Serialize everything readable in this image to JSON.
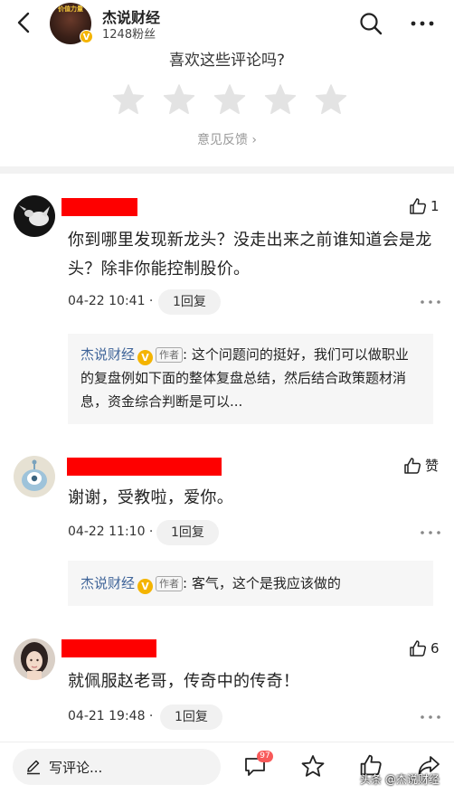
{
  "header": {
    "account_name": "杰说财经",
    "fans": "1248粉丝",
    "avatar_text": "价值力量",
    "badge": "V"
  },
  "rating": {
    "title": "喜欢这些评论吗?",
    "feedback_link": "意见反馈 ›"
  },
  "comments": [
    {
      "likes": "1",
      "text": "你到哪里发现新龙头？没走出来之前谁知道会是龙头？除非你能控制股价。",
      "time": "04-22 10:41 ·",
      "reply_btn": "1回复",
      "reply": {
        "author": "杰说财经",
        "badge": "V",
        "tag": "作者",
        "text": ": 这个问题问的挺好，我们可以做职业的复盘例如下面的整体复盘总结，然后结合政策题材消息，资金综合判断是可以..."
      }
    },
    {
      "likes": "赞",
      "text": "谢谢，受教啦，爱你。",
      "time": "04-22 11:10 ·",
      "reply_btn": "1回复",
      "reply": {
        "author": "杰说财经",
        "badge": "V",
        "tag": "作者",
        "text": ": 客气，这个是我应该做的"
      }
    },
    {
      "likes": "6",
      "text": "就佩服赵老哥，传奇中的传奇！",
      "time": "04-21 19:48 ·",
      "reply_btn": "1回复"
    }
  ],
  "bottom_bar": {
    "compose_label": "写评论...",
    "comment_count": "97",
    "watermark": "头条 @杰说财经"
  },
  "colors": {
    "redaction": "#fe0000",
    "reply_author": "#406599",
    "verified_badge": "#f4b400",
    "count_badge": "#f85959"
  }
}
